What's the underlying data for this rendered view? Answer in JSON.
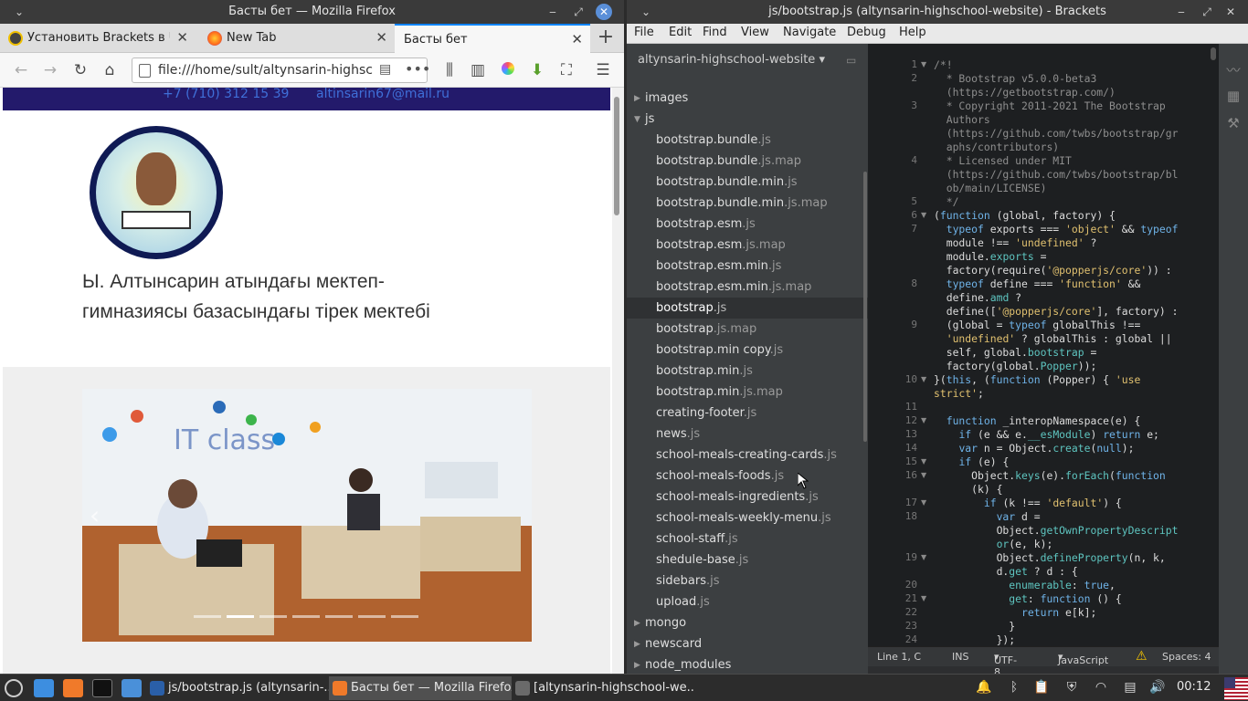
{
  "firefox": {
    "window_title": "Басты бет — Mozilla Firefox",
    "tabs": [
      {
        "label": "Установить Brackets в Ub"
      },
      {
        "label": "New Tab"
      },
      {
        "label": "Басты бет"
      }
    ],
    "url": "file:///home/sult/altynsarin-highschool",
    "page": {
      "phone": "+7 (710) 312 15 39",
      "email": "altinsarin67@mail.ru",
      "school_name": "Ы. Алтынсарин атындағы мектеп-гимназиясы базасындағы тірек мектебі",
      "photo_caption": "IT class",
      "carousel_slides": 7,
      "carousel_active": 2
    }
  },
  "brackets": {
    "window_title": "js/bootstrap.js (altynsarin-highschool-website) - Brackets",
    "menu": [
      "File",
      "Edit",
      "Find",
      "View",
      "Navigate",
      "Debug",
      "Help"
    ],
    "project": "altynsarin-highschool-website",
    "tree": [
      {
        "name": "images",
        "ext": "",
        "folder": true,
        "open": false
      },
      {
        "name": "js",
        "ext": "",
        "folder": true,
        "open": true
      },
      {
        "name": "bootstrap.bundle",
        "ext": ".js"
      },
      {
        "name": "bootstrap.bundle",
        "ext": ".js.map"
      },
      {
        "name": "bootstrap.bundle.min",
        "ext": ".js"
      },
      {
        "name": "bootstrap.bundle.min",
        "ext": ".js.map"
      },
      {
        "name": "bootstrap.esm",
        "ext": ".js"
      },
      {
        "name": "bootstrap.esm",
        "ext": ".js.map"
      },
      {
        "name": "bootstrap.esm.min",
        "ext": ".js"
      },
      {
        "name": "bootstrap.esm.min",
        "ext": ".js.map"
      },
      {
        "name": "bootstrap",
        "ext": ".js",
        "selected": true
      },
      {
        "name": "bootstrap",
        "ext": ".js.map"
      },
      {
        "name": "bootstrap.min copy",
        "ext": ".js"
      },
      {
        "name": "bootstrap.min",
        "ext": ".js"
      },
      {
        "name": "bootstrap.min",
        "ext": ".js.map"
      },
      {
        "name": "creating-footer",
        "ext": ".js"
      },
      {
        "name": "news",
        "ext": ".js"
      },
      {
        "name": "school-meals-creating-cards",
        "ext": ".js"
      },
      {
        "name": "school-meals-foods",
        "ext": ".js"
      },
      {
        "name": "school-meals-ingredients",
        "ext": ".js"
      },
      {
        "name": "school-meals-weekly-menu",
        "ext": ".js"
      },
      {
        "name": "school-staff",
        "ext": ".js"
      },
      {
        "name": "shedule-base",
        "ext": ".js"
      },
      {
        "name": "sidebars",
        "ext": ".js"
      },
      {
        "name": "upload",
        "ext": ".js"
      },
      {
        "name": "mongo",
        "ext": "",
        "folder": true,
        "open": false
      },
      {
        "name": "newscard",
        "ext": "",
        "folder": true,
        "open": false
      },
      {
        "name": "node_modules",
        "ext": "",
        "folder": true,
        "open": false
      }
    ],
    "code_lines": [
      {
        "n": "1",
        "fold": true,
        "html": "<span class=\"cm\">/*!</span>"
      },
      {
        "n": "2",
        "html": "<span class=\"cm\">  * Bootstrap v5.0.0-beta3</span>"
      },
      {
        "n": "",
        "html": "<span class=\"cm\">  (https://getbootstrap.com/)</span>"
      },
      {
        "n": "3",
        "html": "<span class=\"cm\">  * Copyright 2011-2021 The Bootstrap</span>"
      },
      {
        "n": "",
        "html": "<span class=\"cm\">  Authors</span>"
      },
      {
        "n": "",
        "html": "<span class=\"cm\">  (https://github.com/twbs/bootstrap/gr</span>"
      },
      {
        "n": "",
        "html": "<span class=\"cm\">  aphs/contributors)</span>"
      },
      {
        "n": "4",
        "html": "<span class=\"cm\">  * Licensed under MIT</span>"
      },
      {
        "n": "",
        "html": "<span class=\"cm\">  (https://github.com/twbs/bootstrap/bl</span>"
      },
      {
        "n": "",
        "html": "<span class=\"cm\">  ob/main/LICENSE)</span>"
      },
      {
        "n": "5",
        "html": "<span class=\"cm\">  */</span>"
      },
      {
        "n": "6",
        "fold": true,
        "html": "(<span class=\"kw\">function</span> (global, factory) {"
      },
      {
        "n": "7",
        "html": "  <span class=\"kw\">typeof</span> exports === <span class=\"st\">'object'</span> &amp;&amp; <span class=\"kw\">typeof</span>"
      },
      {
        "n": "",
        "html": "  module !== <span class=\"st\">'undefined'</span> ?"
      },
      {
        "n": "",
        "html": "  module.<span class=\"pr\">exports</span> ="
      },
      {
        "n": "",
        "html": "  factory(require(<span class=\"st\">'@popperjs/core'</span>)) :"
      },
      {
        "n": "8",
        "html": "  <span class=\"kw\">typeof</span> define === <span class=\"st\">'function'</span> &amp;&amp;"
      },
      {
        "n": "",
        "html": "  define.<span class=\"pr\">amd</span> ?"
      },
      {
        "n": "",
        "html": "  define([<span class=\"st\">'@popperjs/core'</span>], factory) :"
      },
      {
        "n": "9",
        "html": "  (global = <span class=\"kw\">typeof</span> globalThis !=="
      },
      {
        "n": "",
        "html": "  <span class=\"st\">'undefined'</span> ? globalThis : global ||"
      },
      {
        "n": "",
        "html": "  self, global.<span class=\"pr\">bootstrap</span> ="
      },
      {
        "n": "",
        "html": "  factory(global.<span class=\"pr\">Popper</span>));"
      },
      {
        "n": "10",
        "fold": true,
        "html": "}(<span class=\"kw\">this</span>, (<span class=\"kw\">function</span> (Popper) { <span class=\"st\">'use</span>"
      },
      {
        "n": "",
        "html": "<span class=\"st\">strict'</span>;"
      },
      {
        "n": "11",
        "html": ""
      },
      {
        "n": "12",
        "fold": true,
        "html": "  <span class=\"kw\">function</span> _interopNamespace(e) {"
      },
      {
        "n": "13",
        "html": "    <span class=\"kw\">if</span> (e &amp;&amp; e.<span class=\"pr\">__esModule</span>) <span class=\"kw\">return</span> e;"
      },
      {
        "n": "14",
        "html": "    <span class=\"kw\">var</span> n = Object.<span class=\"pr\">create</span>(<span class=\"kw\">null</span>);"
      },
      {
        "n": "15",
        "fold": true,
        "html": "    <span class=\"kw\">if</span> (e) {"
      },
      {
        "n": "16",
        "fold": true,
        "html": "      Object.<span class=\"pr\">keys</span>(e).<span class=\"pr\">forEach</span>(<span class=\"kw\">function</span>"
      },
      {
        "n": "",
        "html": "      (k) {"
      },
      {
        "n": "17",
        "fold": true,
        "html": "        <span class=\"kw\">if</span> (k !== <span class=\"st\">'default'</span>) {"
      },
      {
        "n": "18",
        "html": "          <span class=\"kw\">var</span> d ="
      },
      {
        "n": "",
        "html": "          Object.<span class=\"pr\">getOwnPropertyDescript</span>"
      },
      {
        "n": "",
        "html": "          <span class=\"pr\">or</span>(e, k);"
      },
      {
        "n": "19",
        "fold": true,
        "html": "          Object.<span class=\"pr\">defineProperty</span>(n, k,"
      },
      {
        "n": "",
        "html": "          d.<span class=\"pr\">get</span> ? d : {"
      },
      {
        "n": "20",
        "html": "            <span class=\"pr\">enumerable</span>: <span class=\"kw\">true</span>,"
      },
      {
        "n": "21",
        "fold": true,
        "html": "            <span class=\"pr\">get</span>: <span class=\"kw\">function</span> () {"
      },
      {
        "n": "22",
        "html": "              <span class=\"kw\">return</span> e[k];"
      },
      {
        "n": "23",
        "html": "            }"
      },
      {
        "n": "24",
        "html": "          });"
      }
    ],
    "status": {
      "cursor": "Line 1, C",
      "mode": "INS",
      "encoding": "UTF-8",
      "language": "JavaScript",
      "spaces": "Spaces: 4"
    }
  },
  "taskbar": {
    "tasks": [
      {
        "label": "js/bootstrap.js (altynsarin-..."
      },
      {
        "label": "Басты бет — Mozilla Firefox",
        "active": true
      },
      {
        "label": "[altynsarin-highschool-we..."
      }
    ],
    "clock": "00:12"
  },
  "colors": {
    "selection_blue": "#0a84ff",
    "page_topbar": "#231a6b",
    "brackets_sidebar": "#3c3f41",
    "editor_bg": "#1d1f21"
  }
}
